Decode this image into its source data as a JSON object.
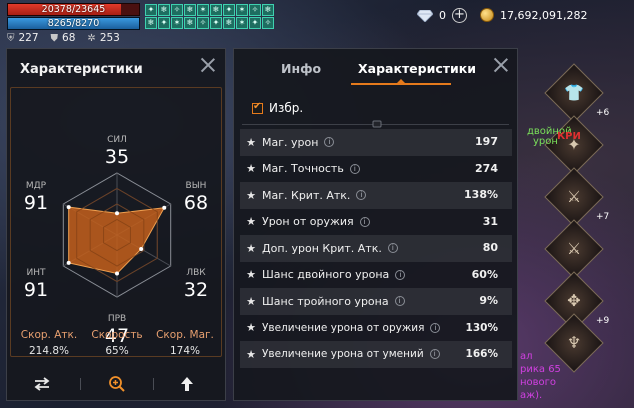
{
  "hud": {
    "hp": {
      "text": "20378/23645",
      "fraction": 0.862
    },
    "mp": {
      "text": "8265/8270",
      "fraction": 0.999
    },
    "stats": [
      {
        "icon": "shield-icon",
        "glyph": "⛨",
        "value": "227"
      },
      {
        "icon": "shield-alt-icon",
        "glyph": "⛊",
        "value": "68"
      },
      {
        "icon": "gear-icon",
        "glyph": "✲",
        "value": "253"
      }
    ],
    "buffs": [
      "✦",
      "❄",
      "✧",
      "❄",
      "✶",
      "❄",
      "✦",
      "✶",
      "✧",
      "❄",
      "❄",
      "✦",
      "✶",
      "❄",
      "✧",
      "✦",
      "❄",
      "✶",
      "✦",
      "✧"
    ],
    "gems": "0",
    "gold": "17,692,091,282"
  },
  "left_panel": {
    "title": "Характеристики",
    "radar": {
      "max": 100,
      "stats": [
        {
          "key": "sil",
          "label": "СИЛ",
          "value": "35",
          "level": 0.35
        },
        {
          "key": "vyn",
          "label": "ВЫН",
          "value": "68",
          "level": 0.88
        },
        {
          "key": "lvk",
          "label": "ЛВК",
          "value": "32",
          "level": 0.45
        },
        {
          "key": "prv",
          "label": "ПРВ",
          "value": "47",
          "level": 0.62
        },
        {
          "key": "int",
          "label": "ИНТ",
          "value": "91",
          "level": 0.9
        },
        {
          "key": "mdr",
          "label": "МДР",
          "value": "91",
          "level": 0.9
        }
      ]
    },
    "bottom_stats": [
      {
        "label": "Скор. Атк.",
        "value": "214.8%"
      },
      {
        "label": "Скорость",
        "value": "65%"
      },
      {
        "label": "Скор. Маг.",
        "value": "174%"
      }
    ],
    "buttons": [
      {
        "icon": "swap-arrows-icon",
        "glyph": "⇄"
      },
      {
        "icon": "magnify-icon",
        "glyph": "⊕"
      },
      {
        "icon": "arrow-up-icon",
        "glyph": "🡅"
      }
    ]
  },
  "right_panel": {
    "tabs": [
      {
        "label": "Инфо",
        "active": false
      },
      {
        "label": "Характеристики",
        "active": true
      }
    ],
    "favorites_label": "Избр.",
    "rows": [
      {
        "name": "Маг. урон",
        "value": "197"
      },
      {
        "name": "Маг. Точность",
        "value": "274"
      },
      {
        "name": "Маг. Крит. Атк.",
        "value": "138%"
      },
      {
        "name": "Урон от оружия",
        "value": "31"
      },
      {
        "name": "Доп. урон Крит. Атк.",
        "value": "80"
      },
      {
        "name": "Шанс двойного урона",
        "value": "60%"
      },
      {
        "name": "Шанс тройного урона",
        "value": "9%"
      },
      {
        "name": "Увеличение урона от оружия",
        "value": "130%"
      },
      {
        "name": "Увеличение урона от умений",
        "value": "166%"
      }
    ],
    "info_glyph": "i",
    "star_glyph": "★"
  },
  "side_items": [
    {
      "glyph": "👕",
      "plus": "+6"
    },
    {
      "glyph": "✦",
      "plus": ""
    },
    {
      "glyph": "⚔",
      "plus": "+7"
    },
    {
      "glyph": "⚔",
      "plus": ""
    },
    {
      "glyph": "✥",
      "plus": "+9"
    },
    {
      "glyph": "♆",
      "plus": ""
    }
  ],
  "chat_fragments": [
    {
      "text": "двойной",
      "color": "#7ae05a"
    },
    {
      "text": "урон",
      "color": "#7ae05a"
    },
    {
      "text": "КРИ",
      "color": "#e03030"
    },
    {
      "text": "ал",
      "color": "#d040e0"
    },
    {
      "text": "рика 65",
      "color": "#d040e0"
    },
    {
      "text": "нового",
      "color": "#d040e0"
    },
    {
      "text": "аж).",
      "color": "#d040e0"
    }
  ],
  "colors": {
    "accent": "#e57a1c",
    "radar_fill": "#c4601c",
    "value_text": "#ffffff",
    "bottom_label": "#e8a070"
  }
}
